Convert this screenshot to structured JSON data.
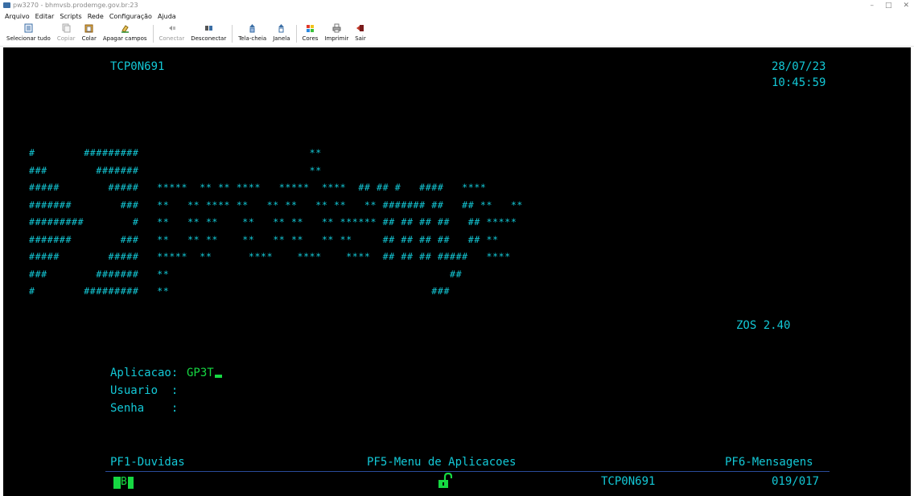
{
  "window": {
    "title": "pw3270 - bhmvsb.prodemge.gov.br:23",
    "minimize": "–",
    "maximize": "□",
    "close": "✕"
  },
  "menubar": [
    "Arquivo",
    "Editar",
    "Scripts",
    "Rede",
    "Configuração",
    "Ajuda"
  ],
  "toolbar": [
    {
      "label": "Selecionar tudo",
      "icon": "select-all-icon",
      "enabled": true
    },
    {
      "label": "Copiar",
      "icon": "copy-icon",
      "enabled": false
    },
    {
      "label": "Colar",
      "icon": "paste-icon",
      "enabled": true
    },
    {
      "label": "Apagar campos",
      "icon": "eraser-icon",
      "enabled": true
    },
    {
      "label": "Conectar",
      "icon": "connect-icon",
      "enabled": false
    },
    {
      "label": "Desconectar",
      "icon": "disconnect-icon",
      "enabled": true
    },
    {
      "label": "Tela-cheia",
      "icon": "fullscreen-icon",
      "enabled": true
    },
    {
      "label": "Janela",
      "icon": "window-icon",
      "enabled": true
    },
    {
      "label": "Cores",
      "icon": "colors-icon",
      "enabled": true
    },
    {
      "label": "Imprimir",
      "icon": "printer-icon",
      "enabled": true
    },
    {
      "label": "Sair",
      "icon": "exit-icon",
      "enabled": true
    }
  ],
  "terminal": {
    "terminal_id": "TCP0N691",
    "date": "28/07/23",
    "time": "10:45:59",
    "logo_art": "#        #########                            **\n###        #######                            **\n#####        #####   *****  ** ** ****   *****  ****  ## ## #   ####   ****\n#######        ###   **   ** **** **   ** **   ** **   ** ####### ##   ## **   **\n#########        #   **   ** **    **   ** **   ** ****** ## ## ## ##   ## *****\n#######        ###   **   ** **    **   ** **   ** **     ## ## ## ##   ## **\n#####        #####   *****  **      ****    ****    ****  ## ## ## #####   ****\n###        #######   **                                              ##\n#        #########   **                                           ###",
    "os_version": "ZOS 2.40",
    "fields": {
      "aplicacao_label": "Aplicacao:",
      "aplicacao_value": "GP3T",
      "usuario_label": "Usuario  :",
      "senha_label": "Senha    :"
    },
    "pf_keys": {
      "pf1": "PF1-Duvidas",
      "pf5": "PF5-Menu de Aplicacoes",
      "pf6": "PF6-Mensagens"
    },
    "status": {
      "indicator": "B",
      "terminal_id": "TCP0N691",
      "cursor_pos": "019/017",
      "lock_icon": "unlocked-padlock-icon"
    },
    "colors": {
      "background": "#000000",
      "cyan_text": "#13c8d6",
      "green_text": "#16d842"
    }
  }
}
